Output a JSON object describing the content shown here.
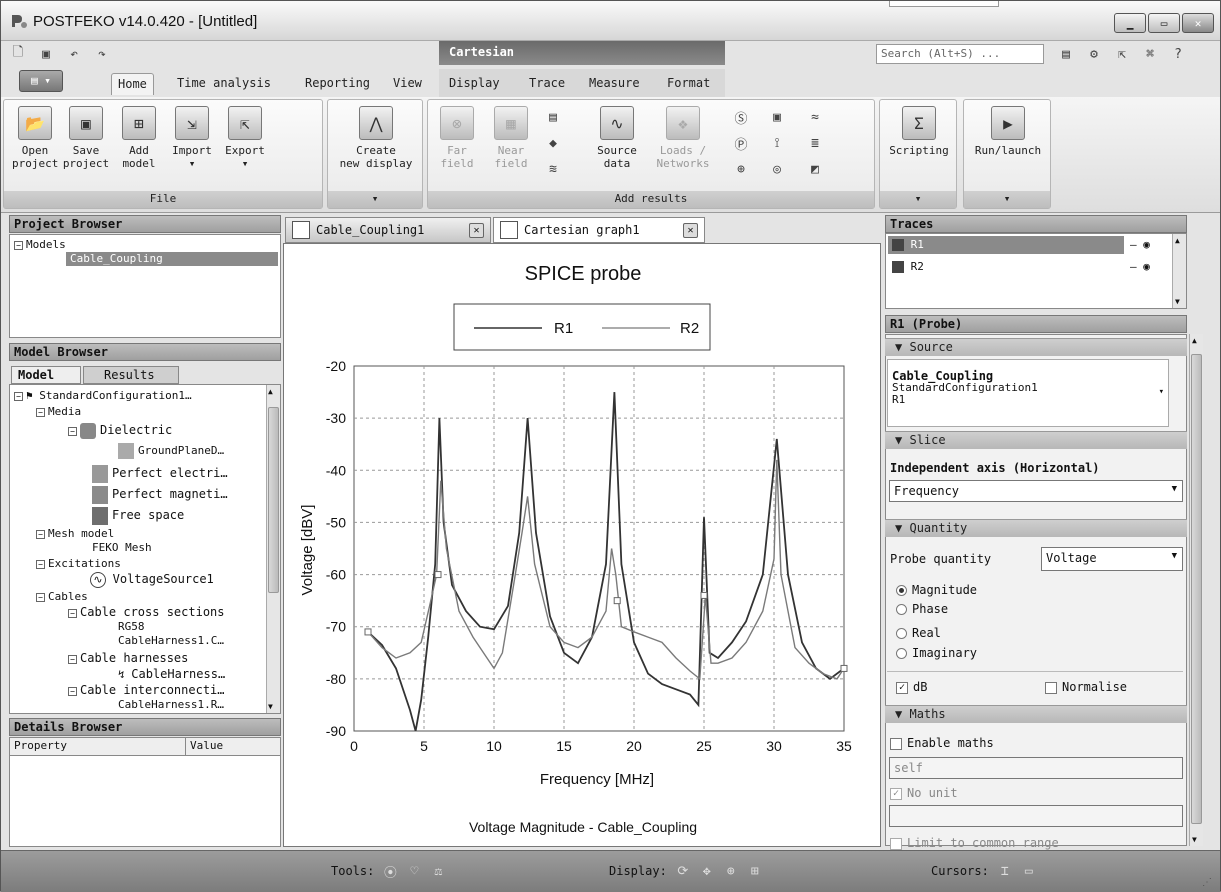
{
  "window": {
    "title": "POSTFEKO v14.0.420 - [Untitled]"
  },
  "context_band": "Cartesian",
  "search": {
    "placeholder": "Search (Alt+S) ..."
  },
  "ribbon_tabs": [
    "Home",
    "Time analysis",
    "Reporting",
    "View",
    "Display",
    "Trace",
    "Measure",
    "Format"
  ],
  "ribbon": {
    "file_group": {
      "label": "File",
      "buttons": [
        "Open\nproject",
        "Save\nproject",
        "Add\nmodel",
        "Import",
        "Export"
      ]
    },
    "display_group": {
      "button": "Create\nnew display"
    },
    "add_results_group": {
      "label": "Add results",
      "buttons": [
        "Far\nfield",
        "Near\nfield",
        "Source\ndata",
        "Loads /\nNetworks"
      ]
    },
    "scripting": "Scripting",
    "run_launch": "Run/launch"
  },
  "project_browser": {
    "title": "Project Browser",
    "root": "Models",
    "selected": "Cable_Coupling"
  },
  "model_browser": {
    "title": "Model Browser",
    "tabs": [
      "Model",
      "Results"
    ],
    "items": [
      "StandardConfiguration1…",
      "Media",
      "Dielectric",
      "GroundPlaneD…",
      "Perfect electri…",
      "Perfect magneti…",
      "Free space",
      "Mesh model",
      "FEKO Mesh",
      "Excitations",
      "VoltageSource1",
      "Cables",
      "Cable cross sections",
      "RG58",
      "CableHarness1.C…",
      "Cable harnesses",
      "CableHarness…",
      "Cable interconnecti…",
      "CableHarness1.R…"
    ]
  },
  "details_browser": {
    "title": "Details Browser",
    "columns": [
      "Property",
      "Value"
    ]
  },
  "doc_tabs": [
    "Cable_Coupling1",
    "Cartesian graph1"
  ],
  "traces_panel": {
    "title": "Traces",
    "items": [
      "R1",
      "R2"
    ]
  },
  "probe_panel": {
    "title": "R1 (Probe)",
    "source_section": "Source",
    "source_lines": [
      "Cable_Coupling",
      "StandardConfiguration1",
      "R1"
    ],
    "slice_section": "Slice",
    "independent_axis_label": "Independent axis (Horizontal)",
    "independent_axis_value": "Frequency",
    "quantity_section": "Quantity",
    "probe_quantity_label": "Probe quantity",
    "probe_quantity_value": "Voltage",
    "radio_options": [
      "Magnitude",
      "Phase",
      "Real",
      "Imaginary"
    ],
    "db_label": "dB",
    "normalise_label": "Normalise",
    "maths_section": "Maths",
    "enable_maths": "Enable maths",
    "maths_expr": "self",
    "no_unit": "No unit",
    "limit_common": "Limit to common range"
  },
  "status_bar": {
    "tools": "Tools:",
    "display": "Display:",
    "cursors": "Cursors:"
  },
  "chart_data": {
    "type": "line",
    "title": "SPICE probe",
    "xlabel": "Frequency [MHz]",
    "ylabel": "Voltage [dBV]",
    "footer": "Voltage Magnitude - Cable_Coupling",
    "xlim": [
      0,
      35
    ],
    "ylim": [
      -90,
      -20
    ],
    "xticks": [
      0,
      5,
      10,
      15,
      20,
      25,
      30,
      35
    ],
    "yticks": [
      -20,
      -30,
      -40,
      -50,
      -60,
      -70,
      -80,
      -90
    ],
    "grid": true,
    "legend": "top",
    "series": [
      {
        "name": "R1",
        "color": "#333333",
        "points": [
          [
            1,
            -71
          ],
          [
            2,
            -73.5
          ],
          [
            3,
            -78
          ],
          [
            4,
            -86
          ],
          [
            4.4,
            -90
          ],
          [
            4.8,
            -84
          ],
          [
            5.3,
            -72
          ],
          [
            5.8,
            -58
          ],
          [
            6.1,
            -30
          ],
          [
            6.4,
            -50
          ],
          [
            7,
            -62
          ],
          [
            8,
            -67
          ],
          [
            9,
            -70
          ],
          [
            10,
            -70.5
          ],
          [
            11,
            -66
          ],
          [
            11.8,
            -52
          ],
          [
            12.4,
            -30
          ],
          [
            13,
            -52
          ],
          [
            14,
            -68
          ],
          [
            15,
            -75
          ],
          [
            16,
            -77
          ],
          [
            17,
            -72
          ],
          [
            18,
            -58
          ],
          [
            18.6,
            -25
          ],
          [
            19.1,
            -58
          ],
          [
            20,
            -73
          ],
          [
            21,
            -79
          ],
          [
            22,
            -81
          ],
          [
            23,
            -82
          ],
          [
            24,
            -83
          ],
          [
            24.6,
            -85
          ],
          [
            25,
            -49
          ],
          [
            25.4,
            -75
          ],
          [
            26,
            -76
          ],
          [
            27,
            -73
          ],
          [
            28,
            -69
          ],
          [
            29.2,
            -60
          ],
          [
            30.2,
            -34
          ],
          [
            31,
            -60
          ],
          [
            32,
            -73
          ],
          [
            33,
            -78
          ],
          [
            34,
            -80
          ],
          [
            35,
            -78
          ]
        ]
      },
      {
        "name": "R2",
        "color": "#7a7a7a",
        "points": [
          [
            1,
            -71
          ],
          [
            2,
            -74
          ],
          [
            3,
            -76
          ],
          [
            4,
            -75
          ],
          [
            4.8,
            -73
          ],
          [
            5.4,
            -66
          ],
          [
            5.9,
            -60
          ],
          [
            6.2,
            -42
          ],
          [
            6.6,
            -55
          ],
          [
            7.5,
            -67
          ],
          [
            8.5,
            -72
          ],
          [
            9.5,
            -76
          ],
          [
            10,
            -78
          ],
          [
            10.6,
            -75
          ],
          [
            11.4,
            -62
          ],
          [
            12,
            -52
          ],
          [
            12.4,
            -45
          ],
          [
            12.9,
            -58
          ],
          [
            14,
            -70
          ],
          [
            15,
            -73
          ],
          [
            16,
            -74
          ],
          [
            17,
            -72
          ],
          [
            18,
            -67
          ],
          [
            18.4,
            -55
          ],
          [
            18.7,
            -60
          ],
          [
            19.1,
            -70
          ],
          [
            20,
            -71
          ],
          [
            21,
            -72
          ],
          [
            22,
            -73
          ],
          [
            23,
            -76
          ],
          [
            24,
            -78.5
          ],
          [
            24.7,
            -80
          ],
          [
            25.1,
            -64
          ],
          [
            25.5,
            -77
          ],
          [
            26,
            -77
          ],
          [
            27,
            -76
          ],
          [
            28,
            -73
          ],
          [
            29.2,
            -67
          ],
          [
            30,
            -57
          ],
          [
            30.2,
            -38
          ],
          [
            30.5,
            -60
          ],
          [
            31.5,
            -74
          ],
          [
            32.5,
            -77
          ],
          [
            33.5,
            -79
          ],
          [
            34.5,
            -80
          ],
          [
            35,
            -78
          ]
        ]
      }
    ],
    "markers": [
      [
        1,
        -71
      ],
      [
        6,
        -60
      ],
      [
        18.8,
        -65
      ],
      [
        25,
        -64
      ],
      [
        35,
        -78
      ]
    ]
  }
}
